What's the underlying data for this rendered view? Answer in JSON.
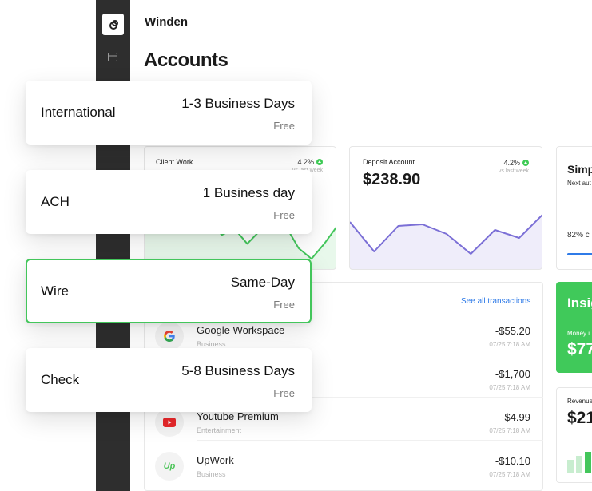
{
  "app": {
    "name": "Winden"
  },
  "page": {
    "title": "Accounts"
  },
  "cards": {
    "client_work": {
      "label": "Client Work",
      "change": "4.2%",
      "change_sub": "vs last week"
    },
    "deposit": {
      "label": "Deposit Account",
      "amount": "$238.90",
      "change": "4.2%",
      "change_sub": "vs last week"
    },
    "simple": {
      "title": "Simp",
      "sub": "Next aut",
      "percent": "82% c"
    },
    "insights": {
      "title": "Insig",
      "label": "Money i",
      "amount": "$77"
    },
    "revenue": {
      "label": "Revenue",
      "amount": "$21"
    }
  },
  "transactions": {
    "see_all": "See all transactions",
    "items": [
      {
        "name": "Google Workspace",
        "category": "Business",
        "amount": "-$55.20",
        "date": "07/25 7:18 AM",
        "icon": "google-icon"
      },
      {
        "name": "",
        "category": "",
        "amount": "-$1,700",
        "date": "07/25 7:18 AM",
        "icon": ""
      },
      {
        "name": "Youtube Premium",
        "category": "Entertainment",
        "amount": "-$4.99",
        "date": "07/25 7:18 AM",
        "icon": "youtube-icon"
      },
      {
        "name": "UpWork",
        "category": "Business",
        "amount": "-$10.10",
        "date": "07/25 7:18 AM",
        "icon": "upwork-icon",
        "icon_text": "Up"
      }
    ]
  },
  "transfer_options": [
    {
      "name": "International",
      "time": "1-3 Business Days",
      "cost": "Free",
      "selected": false
    },
    {
      "name": "ACH",
      "time": "1 Business day",
      "cost": "Free",
      "selected": false
    },
    {
      "name": "Wire",
      "time": "Same-Day",
      "cost": "Free",
      "selected": true
    },
    {
      "name": "Check",
      "time": "5-8 Business Days",
      "cost": "Free",
      "selected": false
    }
  ],
  "colors": {
    "accent_green": "#43c65b",
    "sidebar": "#2e2e2e",
    "line_purple": "#7b6fd6",
    "link_blue": "#2f7be8"
  },
  "chart_data": [
    {
      "type": "area",
      "title": "Client Work",
      "values": [
        60,
        55,
        48,
        70,
        40,
        55,
        35,
        42,
        25,
        40,
        58,
        45,
        20,
        8,
        25,
        45
      ],
      "color": "#43c65b"
    },
    {
      "type": "area",
      "title": "Deposit Account",
      "values": [
        55,
        18,
        50,
        52,
        40,
        15,
        45,
        35,
        65
      ],
      "color": "#7b6fd6"
    }
  ]
}
